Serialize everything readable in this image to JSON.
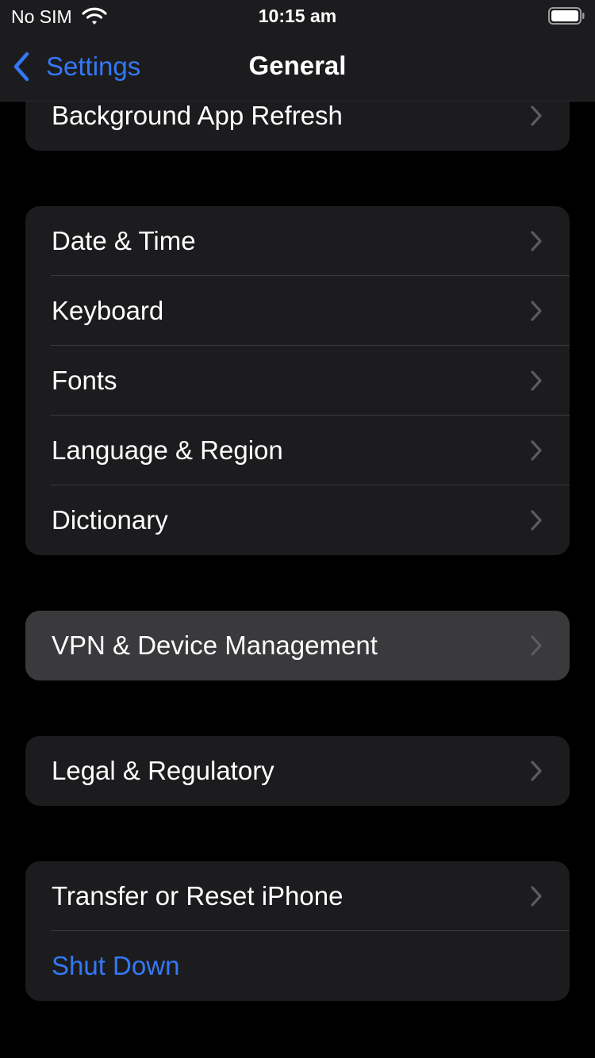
{
  "status_bar": {
    "carrier": "No SIM",
    "time": "10:15 am",
    "icons": [
      "wifi-icon",
      "battery-icon"
    ]
  },
  "nav": {
    "back_label": "Settings",
    "title": "General",
    "back_icon": "chevron-left-icon"
  },
  "colors": {
    "background": "#000000",
    "cell": "#1c1c1e",
    "cell_highlighted": "#3a3a3c",
    "accent": "#3478f6",
    "chevron": "#5b5b60"
  },
  "groups": [
    {
      "items": [
        {
          "label": "Background App Refresh",
          "icon": "chevron-right-icon"
        }
      ]
    },
    {
      "items": [
        {
          "label": "Date & Time",
          "icon": "chevron-right-icon"
        },
        {
          "label": "Keyboard",
          "icon": "chevron-right-icon"
        },
        {
          "label": "Fonts",
          "icon": "chevron-right-icon"
        },
        {
          "label": "Language & Region",
          "icon": "chevron-right-icon"
        },
        {
          "label": "Dictionary",
          "icon": "chevron-right-icon"
        }
      ]
    },
    {
      "items": [
        {
          "label": "VPN & Device Management",
          "icon": "chevron-right-icon",
          "highlighted": true
        }
      ]
    },
    {
      "items": [
        {
          "label": "Legal & Regulatory",
          "icon": "chevron-right-icon"
        }
      ]
    },
    {
      "items": [
        {
          "label": "Transfer or Reset iPhone",
          "icon": "chevron-right-icon"
        },
        {
          "label": "Shut Down"
        }
      ]
    }
  ]
}
